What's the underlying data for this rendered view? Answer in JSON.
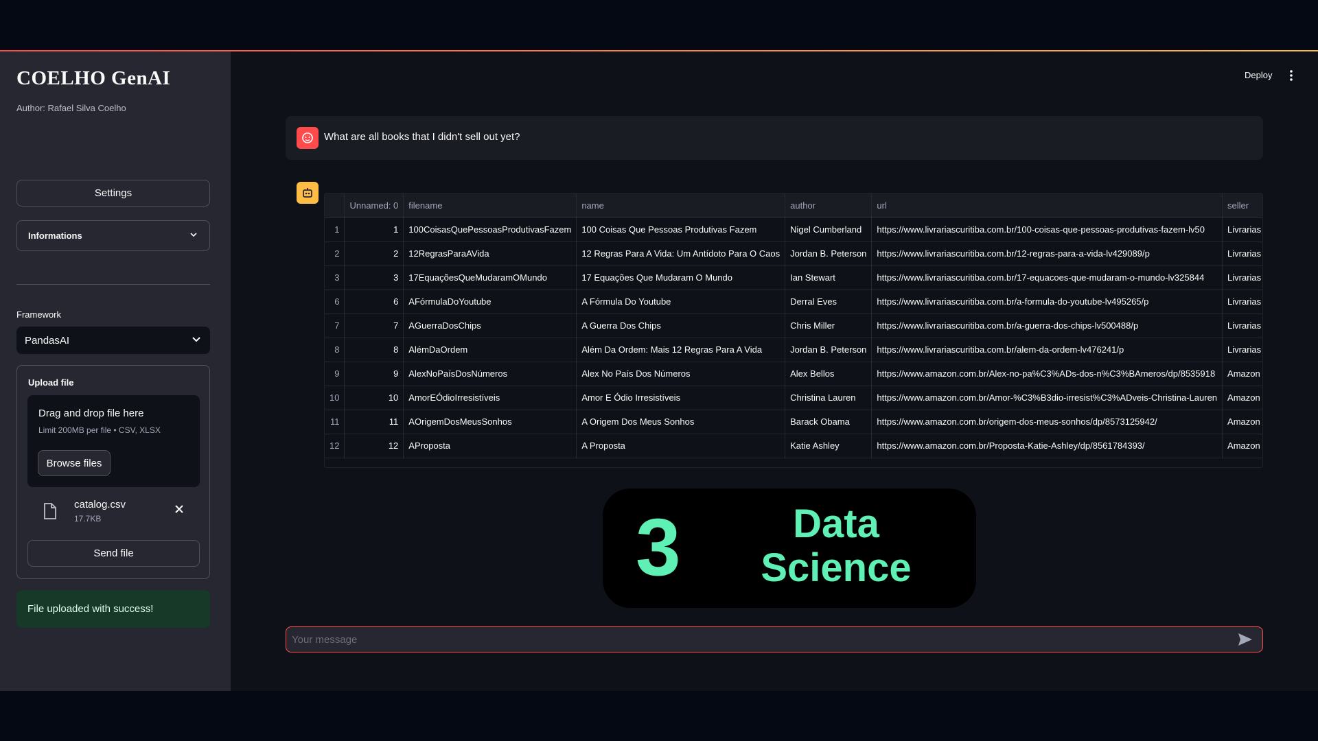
{
  "app": {
    "title": "COELHO GenAI",
    "author": "Author: Rafael Silva Coelho"
  },
  "sidebar": {
    "settings_label": "Settings",
    "informations_label": "Informations",
    "framework_label": "Framework",
    "framework_value": "PandasAI",
    "upload": {
      "title": "Upload file",
      "drop_text": "Drag and drop file here",
      "limit_text": "Limit 200MB per file • CSV, XLSX",
      "browse_label": "Browse files",
      "file_name": "catalog.csv",
      "file_size": "17.7KB",
      "send_label": "Send file"
    },
    "success_message": "File uploaded with success!"
  },
  "header": {
    "deploy_label": "Deploy"
  },
  "chat": {
    "user_message": "What are all books that I didn't sell out yet?",
    "input_placeholder": "Your message"
  },
  "table": {
    "columns": [
      "",
      "Unnamed: 0",
      "filename",
      "name",
      "author",
      "url",
      "seller"
    ],
    "rows": [
      [
        "1",
        "1",
        "100CoisasQuePessoasProdutivasFazem",
        "100 Coisas Que Pessoas Produtivas Fazem",
        "Nigel Cumberland",
        "https://www.livrariascuritiba.com.br/100-coisas-que-pessoas-produtivas-fazem-lv50",
        "Livrarias C"
      ],
      [
        "2",
        "2",
        "12RegrasParaAVida",
        "12 Regras Para A Vida: Um Antídoto Para O Caos",
        "Jordan B. Peterson",
        "https://www.livrariascuritiba.com.br/12-regras-para-a-vida-lv429089/p",
        "Livrarias C"
      ],
      [
        "3",
        "3",
        "17EquaçõesQueMudaramOMundo",
        "17 Equações Que Mudaram O Mundo",
        "Ian Stewart",
        "https://www.livrariascuritiba.com.br/17-equacoes-que-mudaram-o-mundo-lv325844",
        "Livrarias C"
      ],
      [
        "6",
        "6",
        "AFórmulaDoYoutube",
        "A Fórmula Do Youtube",
        "Derral Eves",
        "https://www.livrariascuritiba.com.br/a-formula-do-youtube-lv495265/p",
        "Livrarias C"
      ],
      [
        "7",
        "7",
        "AGuerraDosChips",
        "A Guerra Dos Chips",
        "Chris Miller",
        "https://www.livrariascuritiba.com.br/a-guerra-dos-chips-lv500488/p",
        "Livrarias C"
      ],
      [
        "8",
        "8",
        "AlémDaOrdem",
        "Além Da Ordem: Mais 12 Regras Para A Vida",
        "Jordan B. Peterson",
        "https://www.livrariascuritiba.com.br/alem-da-ordem-lv476241/p",
        "Livrarias C"
      ],
      [
        "9",
        "9",
        "AlexNoPaísDosNúmeros",
        "Alex No País Dos Números",
        "Alex Bellos",
        "https://www.amazon.com.br/Alex-no-pa%C3%ADs-dos-n%C3%BAmeros/dp/8535918",
        "Amazon"
      ],
      [
        "10",
        "10",
        "AmorEÓdioIrresistíveis",
        "Amor E Ódio Irresistíveis",
        "Christina Lauren",
        "https://www.amazon.com.br/Amor-%C3%B3dio-irresist%C3%ADveis-Christina-Lauren",
        "Amazon"
      ],
      [
        "11",
        "11",
        "AOrigemDosMeusSonhos",
        "A Origem Dos Meus Sonhos",
        "Barack Obama",
        "https://www.amazon.com.br/origem-dos-meus-sonhos/dp/8573125942/",
        "Amazon"
      ],
      [
        "12",
        "12",
        "AProposta",
        "A Proposta",
        "Katie Ashley",
        "https://www.amazon.com.br/Proposta-Katie-Ashley/dp/8561784393/",
        "Amazon"
      ]
    ]
  },
  "overlay": {
    "number": "3",
    "line1": "Data",
    "line2": "Science"
  },
  "colors": {
    "accent": "#ff4b4b",
    "overlay_green": "#5ef0b4",
    "bot_avatar": "#ffbd45"
  }
}
